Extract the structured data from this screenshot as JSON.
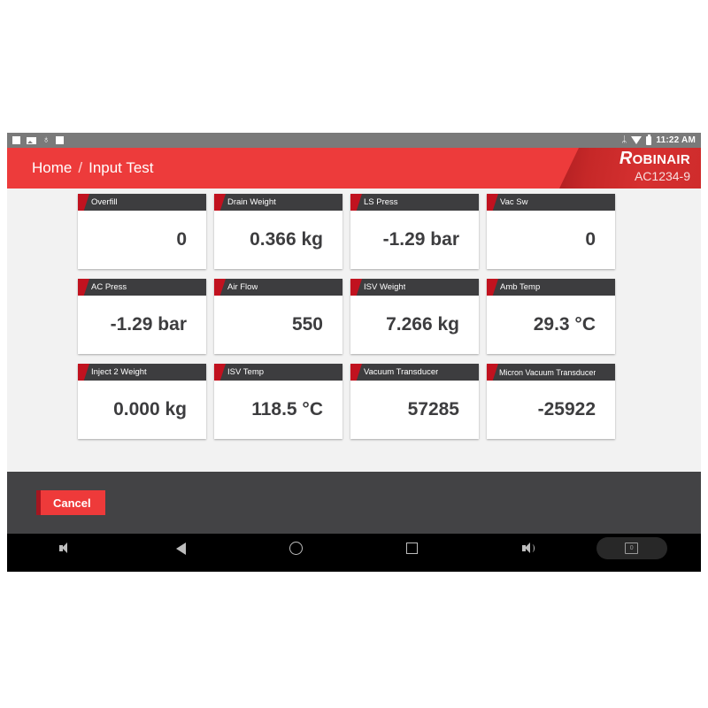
{
  "statusbar": {
    "icons_left": [
      "square-icon",
      "screenshot-icon",
      "usb-icon",
      "square-icon"
    ],
    "usb_glyph": "♁",
    "bluetooth_glyph": "ᛦ",
    "time": "11:22 AM"
  },
  "header": {
    "breadcrumb_home": "Home",
    "breadcrumb_separator": "/",
    "breadcrumb_current": "Input Test",
    "brand_initial": "R",
    "brand_rest": "OBINAIR",
    "model": "AC1234-9",
    "accent_color": "#ed3b3b"
  },
  "cards": [
    {
      "title": "Overfill",
      "value": "0"
    },
    {
      "title": "Drain Weight",
      "value": "0.366 kg"
    },
    {
      "title": "LS Press",
      "value": "-1.29 bar"
    },
    {
      "title": "Vac Sw",
      "value": "0"
    },
    {
      "title": "AC Press",
      "value": "-1.29 bar"
    },
    {
      "title": "Air Flow",
      "value": "550"
    },
    {
      "title": "ISV Weight",
      "value": "7.266 kg"
    },
    {
      "title": "Amb Temp",
      "value": "29.3 °C"
    },
    {
      "title": "Inject 2 Weight",
      "value": "0.000 kg"
    },
    {
      "title": "ISV Temp",
      "value": "118.5 °C"
    },
    {
      "title": "Vacuum Transducer",
      "value": "57285"
    },
    {
      "title": "Micron Vacuum Transducer",
      "value": "-25922"
    }
  ],
  "footer": {
    "cancel_label": "Cancel"
  },
  "navbar": {
    "buttons": [
      "volume-down-icon",
      "back-icon",
      "home-icon",
      "recents-icon",
      "volume-up-icon",
      "screenshot-capture-button"
    ],
    "capture_glyph": "0"
  }
}
